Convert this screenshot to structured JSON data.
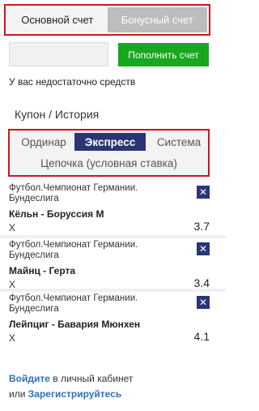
{
  "account": {
    "tabs": [
      {
        "label": "Основной счет",
        "active": true
      },
      {
        "label": "Бонусный счет",
        "active": false
      }
    ]
  },
  "balance": {
    "amount_value": "",
    "topup_label": "Пополнить счет",
    "insufficient": "У вас недостаточно средств"
  },
  "coupon": {
    "title": "Купон / История",
    "bet_types": {
      "single": "Ординар",
      "express": "Экспресс",
      "system": "Система",
      "chain": "Цепочка (условная ставка)",
      "selected": "express"
    }
  },
  "events": [
    {
      "league": "Футбол.Чемпионат Германии. Бундеслига",
      "teams": "Кёльн - Боруссия М",
      "outcome": "X",
      "odds": "3.7",
      "remove": "✕"
    },
    {
      "league": "Футбол.Чемпионат Германии. Бундеслига",
      "teams": "Майнц - Герта",
      "outcome": "X",
      "odds": "3.4",
      "remove": "✕"
    },
    {
      "league": "Футбол.Чемпионат Германии. Бундеслига",
      "teams": "Лейпциг - Бавария Мюнхен",
      "outcome": "X",
      "odds": "4.1",
      "remove": "✕"
    }
  ],
  "auth": {
    "login_link": "Войдите",
    "login_text": " в личный кабинет",
    "or_text": "или ",
    "register_link": "Зарегистрируйтесь"
  },
  "colors": {
    "highlight_border": "#d0141e",
    "accent_navy": "#2a3673",
    "topup_green": "#17a81e",
    "link_blue": "#2f6fbf"
  },
  "icons": {
    "remove": "close-icon"
  }
}
